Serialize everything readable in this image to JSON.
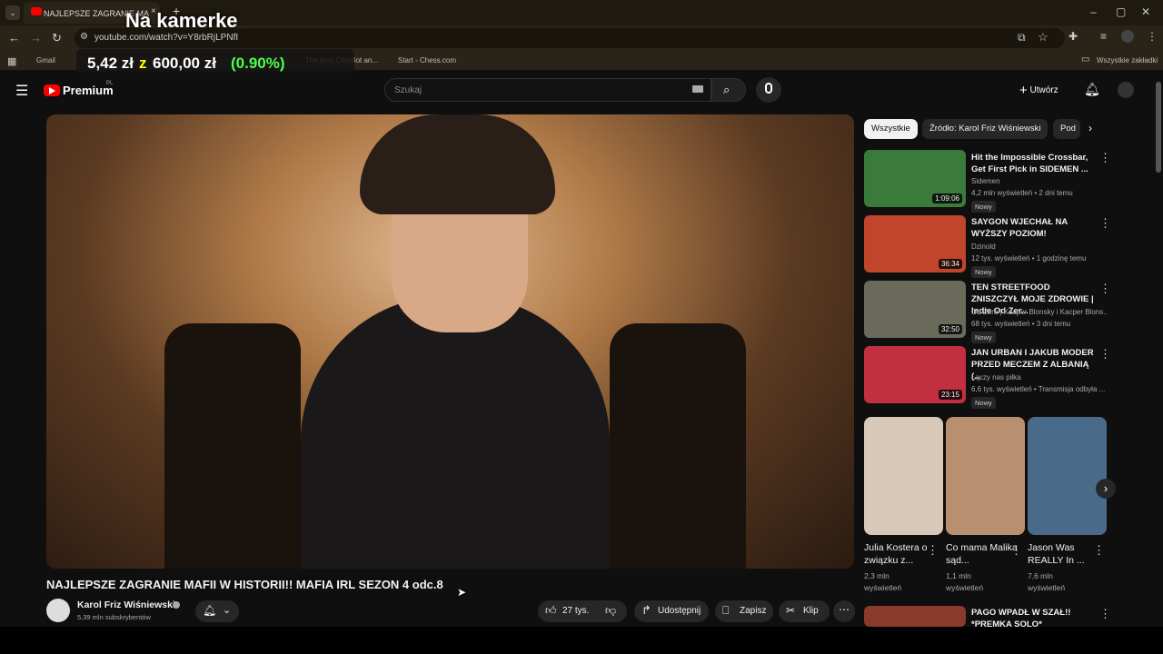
{
  "browser": {
    "tab_title": "NAJLEPSZE ZAGRANIE MA",
    "url": "youtube.com/watch?v=Y8rbRjLPNfI",
    "bookmarks": [
      "Gmail",
      "The best ChatBot an...",
      "Start - Chess.com"
    ],
    "all_bookmarks": "Wszystkie zakładki"
  },
  "overlay": {
    "title": "Na kamerke",
    "price_current": "5,42 zł",
    "price_sep": "z",
    "price_target": "600,00 zł",
    "price_pct": "(0.90%)"
  },
  "header": {
    "logo": "Premium",
    "logo_region": "PL",
    "search_placeholder": "Szukaj",
    "create_label": "Utwórz"
  },
  "video": {
    "title": "NAJLEPSZE ZAGRANIE MAFII W HISTORII!! MAFIA IRL SEZON 4 odc.8",
    "channel": "Karol Friz Wiśniewski",
    "subs": "5,39 mln subskrybentów",
    "likes": "27 tys.",
    "share": "Udostępnij",
    "save": "Zapisz",
    "clip": "Klip"
  },
  "chips": [
    "Wszystkie",
    "Źródło: Karol Friz Wiśniewski",
    "Pod"
  ],
  "recs": [
    {
      "title": "Hit the Impossible Crossbar, Get First Pick in SIDEMEN ...",
      "channel": "Sidemen",
      "meta": "4,2 mln wyświetleń • 2 dni temu",
      "duration": "1:09:06",
      "badge": "Nowy",
      "color": "#3a7a3a"
    },
    {
      "title": "SAYGON WJECHAŁ NA WYŻSZY POZIOM!",
      "channel": "Dzinold",
      "meta": "12 tys. wyświetleń • 1 godzinę temu",
      "duration": "36:34",
      "badge": "Nowy",
      "color": "#c0452a"
    },
    {
      "title": "TEN STREETFOOD ZNISZCZYŁ MOJE ZDROWIE | Indie Od Zer...",
      "channel": "Od Zera | Kacper Blonsky i Kacper Blons...",
      "meta": "68 tys. wyświetleń • 3 dni temu",
      "duration": "32:50",
      "badge": "Nowy",
      "color": "#6a6a5a"
    },
    {
      "title": "JAN URBAN I JAKUB MODER PRZED MECZEM Z ALBANIĄ (...",
      "channel": "Łączy nas piłka",
      "meta": "6,6 tys. wyświetleń • Transmisja odbyła ...",
      "duration": "23:15",
      "badge": "Nowy",
      "color": "#c03040"
    }
  ],
  "shorts": [
    {
      "title": "Julia Kostera o związku z...",
      "views": "2,3 mln wyświetleń",
      "color": "#d8c8b8"
    },
    {
      "title": "Co mama Malika sąd...",
      "views": "1,1 mln wyświetleń",
      "color": "#b89070"
    },
    {
      "title": "Jason Was REALLY In ...",
      "views": "7,6 mln wyświetleń",
      "color": "#4a6a8a"
    }
  ],
  "next_rec": {
    "title": "PAGO WPADŁ W SZAŁ!! *PREMKA SOLO*"
  }
}
